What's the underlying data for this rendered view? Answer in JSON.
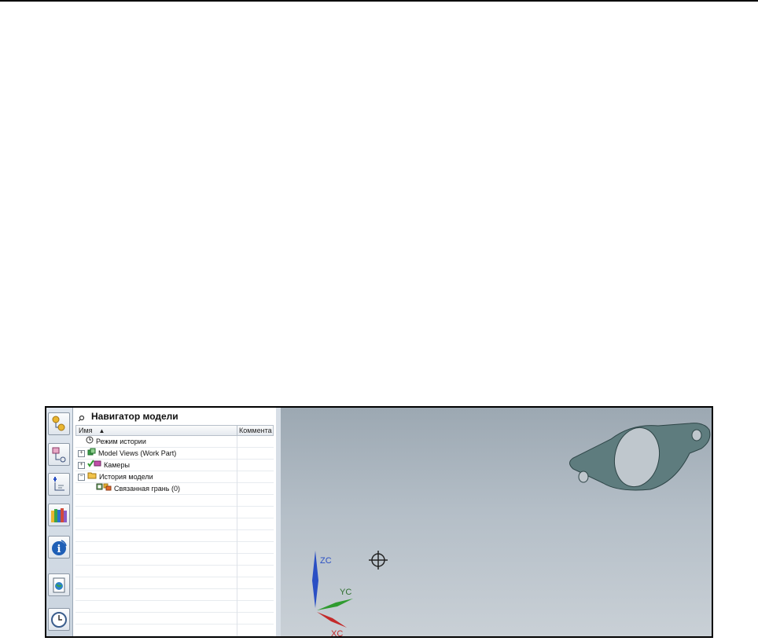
{
  "navigator": {
    "title": "Навигатор модели",
    "columns": {
      "name": "Имя",
      "comment": "Коммента"
    },
    "tree": [
      {
        "label": "Режим истории",
        "icon": "clock-icon",
        "indent": 0,
        "expander": ""
      },
      {
        "label": "Model Views (Work Part)",
        "icon": "model-views-icon",
        "indent": 0,
        "expander": "+"
      },
      {
        "label": "Камеры",
        "icon": "camera-icon",
        "indent": 0,
        "expander": "+"
      },
      {
        "label": "История модели",
        "icon": "folder-icon",
        "indent": 0,
        "expander": "−"
      },
      {
        "label": "Связанная грань (0)",
        "icon": "linked-face-icon",
        "indent": 1,
        "expander": ""
      }
    ]
  },
  "resource_bar": {
    "buttons": [
      "assembly-navigator-icon",
      "constraint-navigator-icon",
      "part-navigator-icon",
      "reuse-library-icon",
      "info-icon",
      "web-browser-icon",
      "history-icon"
    ]
  },
  "graphics": {
    "axes": {
      "z": "ZC",
      "y": "YC",
      "x": "XC"
    },
    "colors": {
      "z": "#2a4fc4",
      "y": "#2f9b2f",
      "x": "#c42a2a",
      "part": "#5e7c7e"
    }
  }
}
